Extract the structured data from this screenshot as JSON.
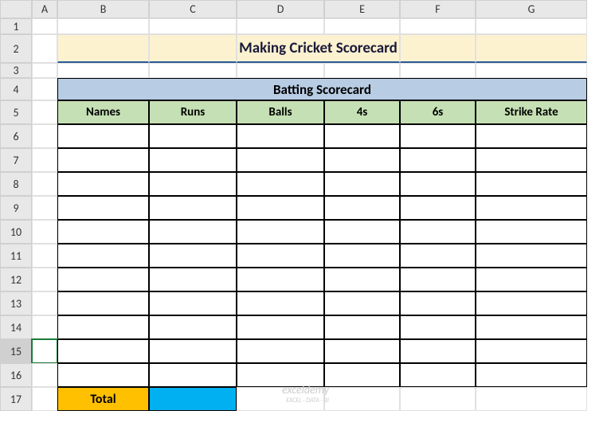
{
  "columns": [
    "",
    "A",
    "B",
    "C",
    "D",
    "E",
    "F",
    "G"
  ],
  "rows": [
    "1",
    "2",
    "3",
    "4",
    "5",
    "6",
    "7",
    "8",
    "9",
    "10",
    "11",
    "12",
    "13",
    "14",
    "15",
    "16",
    "17"
  ],
  "title": "Making Cricket Scorecard",
  "section_title": "Batting Scorecard",
  "headers": {
    "names": "Names",
    "runs": "Runs",
    "balls": "Balls",
    "fours": "4s",
    "sixes": "6s",
    "strike_rate": "Strike Rate"
  },
  "data_rows": [
    {
      "names": "",
      "runs": "",
      "balls": "",
      "fours": "",
      "sixes": "",
      "strike_rate": ""
    },
    {
      "names": "",
      "runs": "",
      "balls": "",
      "fours": "",
      "sixes": "",
      "strike_rate": ""
    },
    {
      "names": "",
      "runs": "",
      "balls": "",
      "fours": "",
      "sixes": "",
      "strike_rate": ""
    },
    {
      "names": "",
      "runs": "",
      "balls": "",
      "fours": "",
      "sixes": "",
      "strike_rate": ""
    },
    {
      "names": "",
      "runs": "",
      "balls": "",
      "fours": "",
      "sixes": "",
      "strike_rate": ""
    },
    {
      "names": "",
      "runs": "",
      "balls": "",
      "fours": "",
      "sixes": "",
      "strike_rate": ""
    },
    {
      "names": "",
      "runs": "",
      "balls": "",
      "fours": "",
      "sixes": "",
      "strike_rate": ""
    },
    {
      "names": "",
      "runs": "",
      "balls": "",
      "fours": "",
      "sixes": "",
      "strike_rate": ""
    },
    {
      "names": "",
      "runs": "",
      "balls": "",
      "fours": "",
      "sixes": "",
      "strike_rate": ""
    },
    {
      "names": "",
      "runs": "",
      "balls": "",
      "fours": "",
      "sixes": "",
      "strike_rate": ""
    },
    {
      "names": "",
      "runs": "",
      "balls": "",
      "fours": "",
      "sixes": "",
      "strike_rate": ""
    }
  ],
  "total_label": "Total",
  "total_value": "",
  "watermark": "exceldemy",
  "watermark_sub": "EXCEL · DATA · BI",
  "selected_row": "15"
}
